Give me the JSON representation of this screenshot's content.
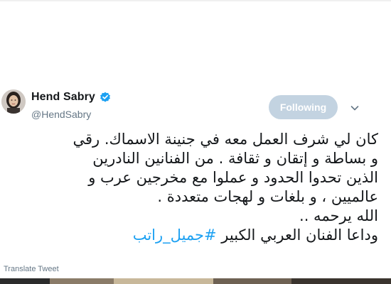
{
  "user": {
    "display_name": "Hend Sabry",
    "handle": "@HendSabry",
    "verified": true
  },
  "actions": {
    "follow_label": "Following",
    "menu_icon": "chevron-down-icon"
  },
  "tweet": {
    "lines": [
      "كان لي شرف العمل معه في جنينة الاسماك. رقي",
      "و بساطة و إتقان و ثقافة . من الفنانين النادرين",
      "الذين تحدوا الحدود و عملوا مع مخرجين عرب و",
      "عالميين ، و بلغات و لهجات متعددة .",
      "الله يرحمه ..",
      "وداعا الفنان العربي الكبير "
    ],
    "hashtag": "#جميل_راتب",
    "translate_label": "Translate Tweet"
  },
  "colors": {
    "link": "#1da1f2",
    "follow_bg": "#c3d3e1",
    "secondary_text": "#657786"
  }
}
